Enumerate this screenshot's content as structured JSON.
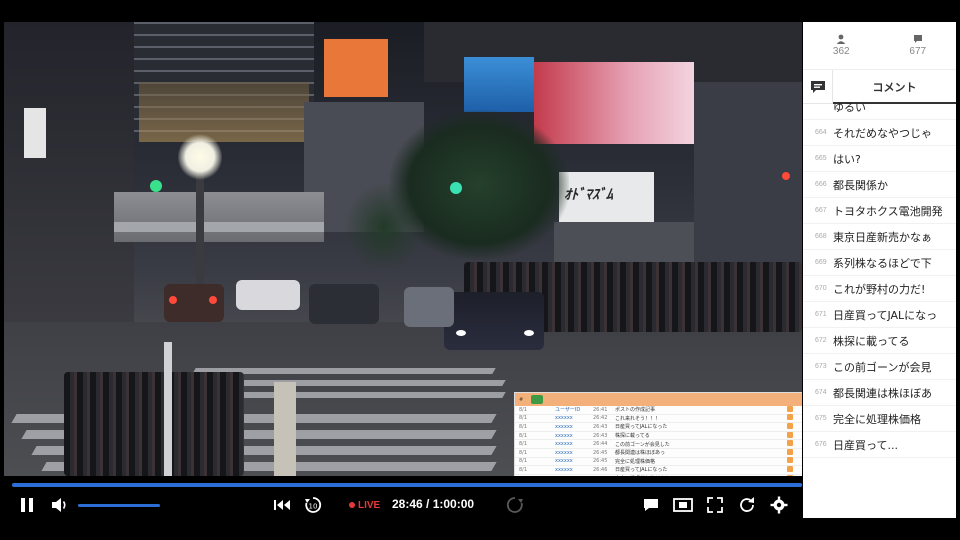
{
  "player": {
    "live_label": "LIVE",
    "time_display": "28:46 / 1:00:00",
    "progress_fraction": 1.0,
    "volume_fraction": 1.0,
    "accent_color": "#2b6fd6",
    "live_color": "#e53935"
  },
  "controls": {
    "pause_icon": "pause-icon",
    "volume_icon": "volume-icon",
    "skip_back_icon": "skip-to-start-icon",
    "rewind_icon": "rewind-10-icon",
    "forward_icon": "forward-icon",
    "comment_toggle_icon": "comment-toggle-icon",
    "theater_icon": "theater-mode-icon",
    "fullscreen_icon": "fullscreen-icon",
    "reload_icon": "reload-icon",
    "settings_icon": "gear-icon"
  },
  "stats": {
    "viewers": "362",
    "comments": "677"
  },
  "tabs": {
    "comment_label": "コメント"
  },
  "comments": [
    {
      "no": "",
      "text": "ゆるい"
    },
    {
      "no": "664",
      "text": "それだめなやつじゃ"
    },
    {
      "no": "665",
      "text": "はい?"
    },
    {
      "no": "666",
      "text": "都長関係か"
    },
    {
      "no": "667",
      "text": "トヨタホクス電池開発"
    },
    {
      "no": "668",
      "text": "東京日産新売かなぁ"
    },
    {
      "no": "669",
      "text": "系列株なるほどで下"
    },
    {
      "no": "670",
      "text": "これが野村の力だ!"
    },
    {
      "no": "671",
      "text": "日産買ってJALになっ"
    },
    {
      "no": "672",
      "text": "株探に載ってる"
    },
    {
      "no": "673",
      "text": "この前ゴーンが会見"
    },
    {
      "no": "674",
      "text": "都長関連は株ほぼあ"
    },
    {
      "no": "675",
      "text": "完全に処理株価格"
    },
    {
      "no": "676",
      "text": "日産買って..."
    }
  ],
  "overlay_chat": {
    "rows": [
      {
        "a": "8/1",
        "b": "ユーザーID",
        "c": "26:41",
        "d": "ポストの作成記事"
      },
      {
        "a": "8/1",
        "b": "xxxxxx",
        "c": "26:42",
        "d": "これ来れそう！！！"
      },
      {
        "a": "8/1",
        "b": "xxxxxx",
        "c": "26:43",
        "d": "日産買ってJALになった"
      },
      {
        "a": "8/1",
        "b": "xxxxxx",
        "c": "26:43",
        "d": "株探に載ってる"
      },
      {
        "a": "8/1",
        "b": "xxxxxx",
        "c": "26:44",
        "d": "この前ゴーンが会見した"
      },
      {
        "a": "8/1",
        "b": "xxxxxx",
        "c": "26:45",
        "d": "都長関連は株ほぼあっ"
      },
      {
        "a": "8/1",
        "b": "xxxxxx",
        "c": "26:45",
        "d": "完全に処理株価格"
      },
      {
        "a": "8/1",
        "b": "xxxxxx",
        "c": "26:46",
        "d": "日産買ってJALになった"
      },
      {
        "a": "8/1",
        "b": "xxxxxx",
        "c": "26:46",
        "d": "完全に処理株価格だよね"
      }
    ]
  }
}
